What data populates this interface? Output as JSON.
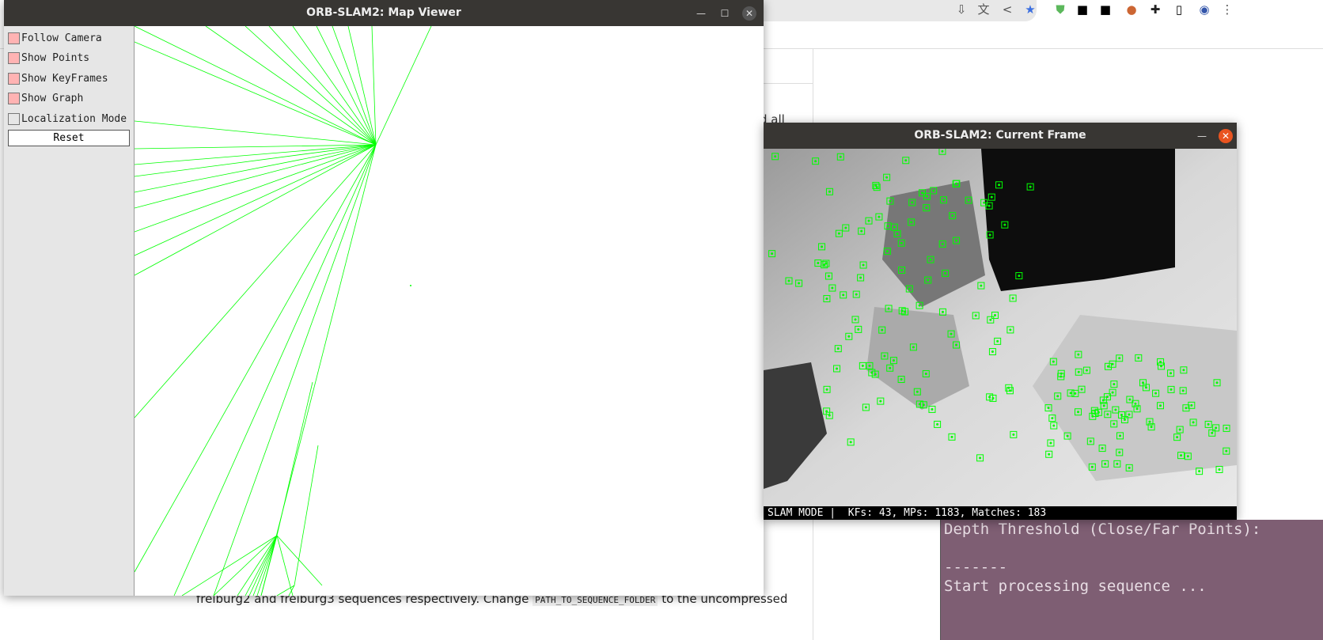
{
  "browser": {
    "icons": [
      "download-icon",
      "translate-icon",
      "share-icon",
      "bookmark-star-icon",
      "shield-extension-icon",
      "extension-icon",
      "extension-icon",
      "extension-icon",
      "puzzle-extensions-icon",
      "sidebar-icon",
      "profile-avatar",
      "menu-dots-icon"
    ]
  },
  "page": {
    "snippet": "d all",
    "bottom_text_before": "freiburg2 and freiburg3 sequences respectively. Change ",
    "bottom_code": "PATH_TO_SEQUENCE_FOLDER",
    "bottom_text_after": " to the uncompressed"
  },
  "map_viewer": {
    "title": "ORB-SLAM2: Map Viewer",
    "options": [
      {
        "label": "Follow Camera",
        "checked": true
      },
      {
        "label": "Show Points",
        "checked": true
      },
      {
        "label": "Show KeyFrames",
        "checked": true
      },
      {
        "label": "Show Graph",
        "checked": true
      },
      {
        "label": "Localization Mode",
        "checked": false
      }
    ],
    "reset_label": "Reset",
    "graph_color": "#00ff00",
    "checked_color": "#ffb3b3"
  },
  "current_frame": {
    "title": "ORB-SLAM2: Current Frame",
    "status": "SLAM MODE |  KFs: 43, MPs: 1183, Matches: 183",
    "feature_color": "#00ff00"
  },
  "terminal": {
    "lines": [
      "Depth Threshold (Close/Far Points): ",
      "",
      "-------",
      "Start processing sequence ..."
    ]
  }
}
